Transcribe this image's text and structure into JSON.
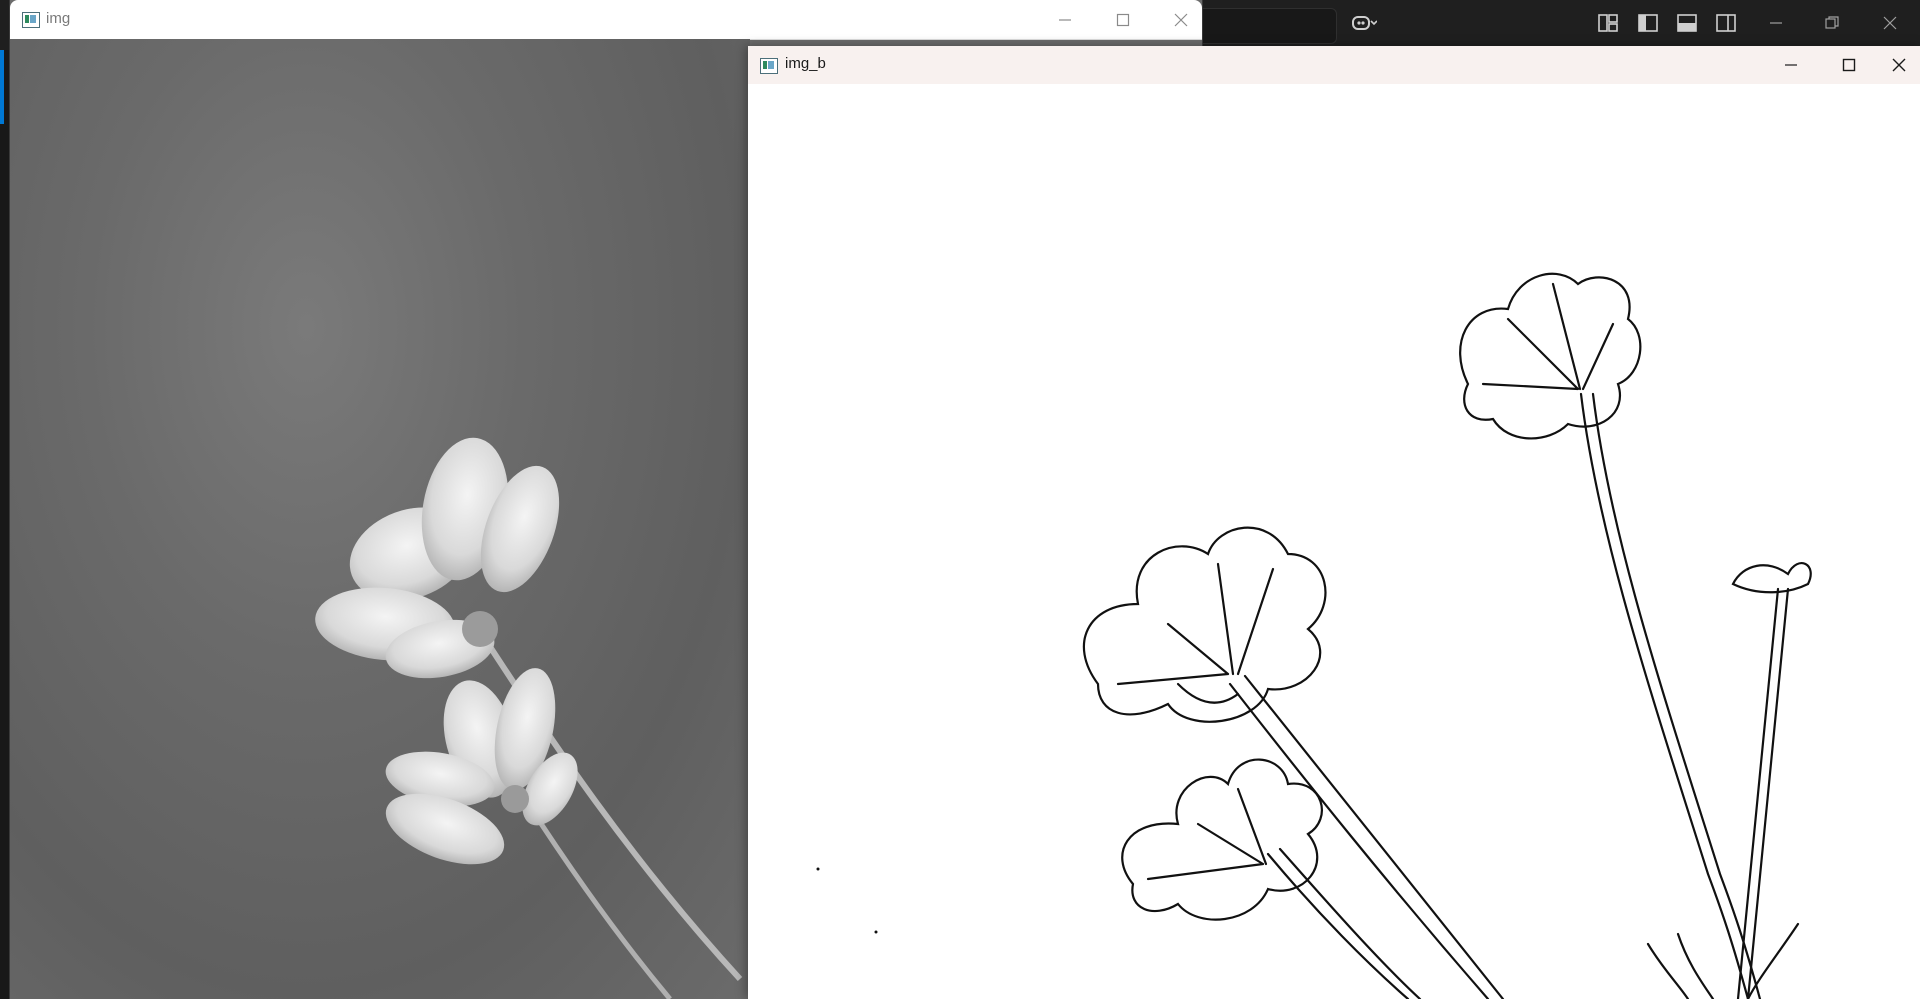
{
  "windows": {
    "img": {
      "title": "img"
    },
    "img_b": {
      "title": "img_b"
    }
  },
  "colors": {
    "ide_background": "#1f1f1f",
    "ide_accent": "#0078d4",
    "img_titlebar": "#ffffff",
    "imgb_titlebar": "#f8f1ef"
  },
  "icons": {
    "app": "opencv-window-icon",
    "minimize": "minimize-icon",
    "maximize": "maximize-icon",
    "close": "close-icon",
    "copilot": "copilot-icon",
    "layouts": [
      "customize-layout-icon",
      "toggle-primary-sidebar-icon",
      "toggle-panel-icon",
      "toggle-secondary-sidebar-icon"
    ]
  }
}
